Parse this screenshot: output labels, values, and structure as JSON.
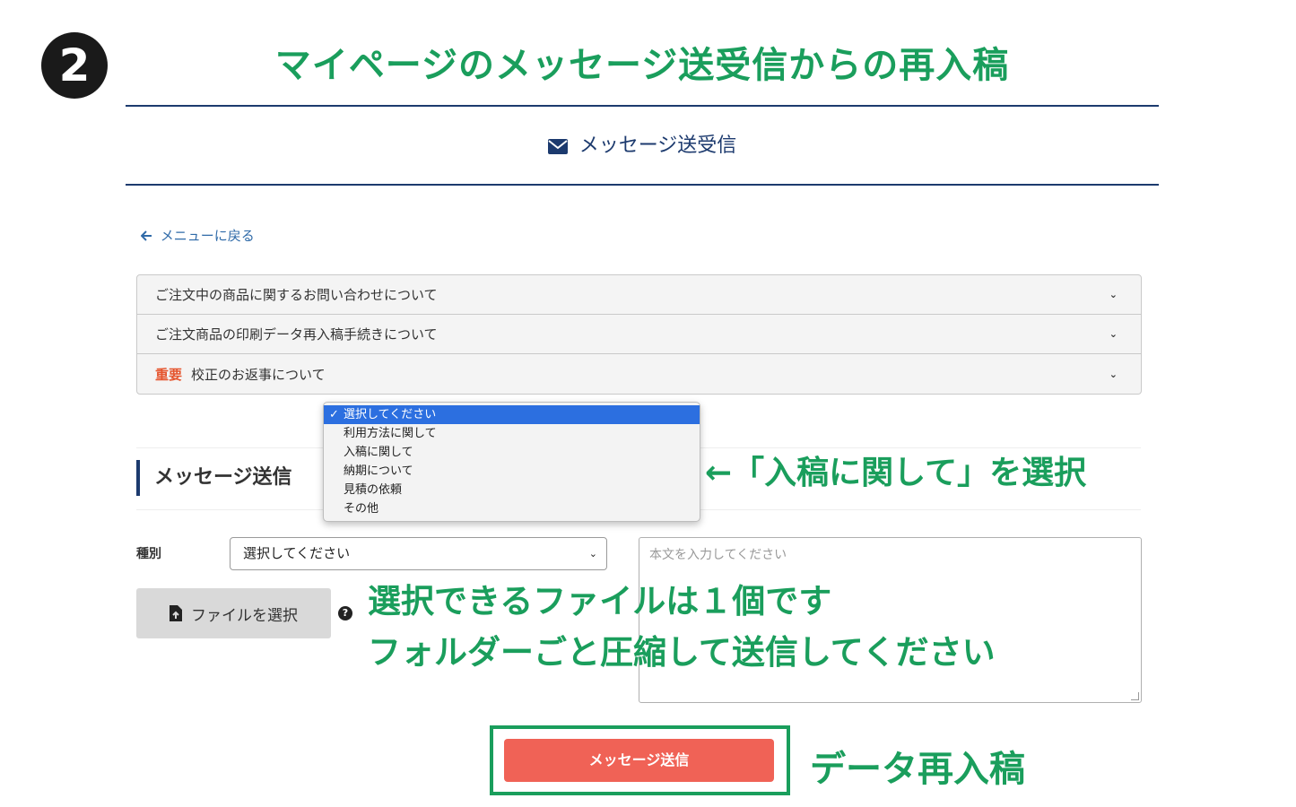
{
  "step": {
    "number": "2"
  },
  "title": "マイページのメッセージ送受信からの再入稿",
  "section_header": {
    "label": "メッセージ送受信",
    "icon": "envelope-icon"
  },
  "back_link": {
    "label": "メニューに戻る",
    "icon": "arrow-left-icon"
  },
  "accordion": [
    {
      "label": "ご注文中の商品に関するお問い合わせについて"
    },
    {
      "label": "ご注文商品の印刷データ再入稿手続きについて"
    },
    {
      "badge": "重要",
      "label": "校正のお返事について"
    }
  ],
  "message_form": {
    "heading": "メッセージ送信",
    "type_label": "種別",
    "type_select": {
      "value": "選択してください",
      "options": [
        "選択してください",
        "利用方法に関して",
        "入稿に関して",
        "納期について",
        "見積の依頼",
        "その他"
      ]
    },
    "body_placeholder": "本文を入力してください",
    "file_button": "ファイルを選択",
    "submit_button": "メッセージ送信"
  },
  "annotations": {
    "select_hint": "←「入稿に関して」を選択",
    "file_hint_line1": "選択できるファイルは１個です",
    "file_hint_line2": "フォルダーごと圧縮して送信してください",
    "submit_hint": "データ再入稿"
  },
  "colors": {
    "annotation_green": "#1a9e5c",
    "navy": "#1c3a6e",
    "submit_red": "#f06256",
    "important_orange": "#e5542d",
    "dropdown_highlight": "#2c6fe0"
  }
}
